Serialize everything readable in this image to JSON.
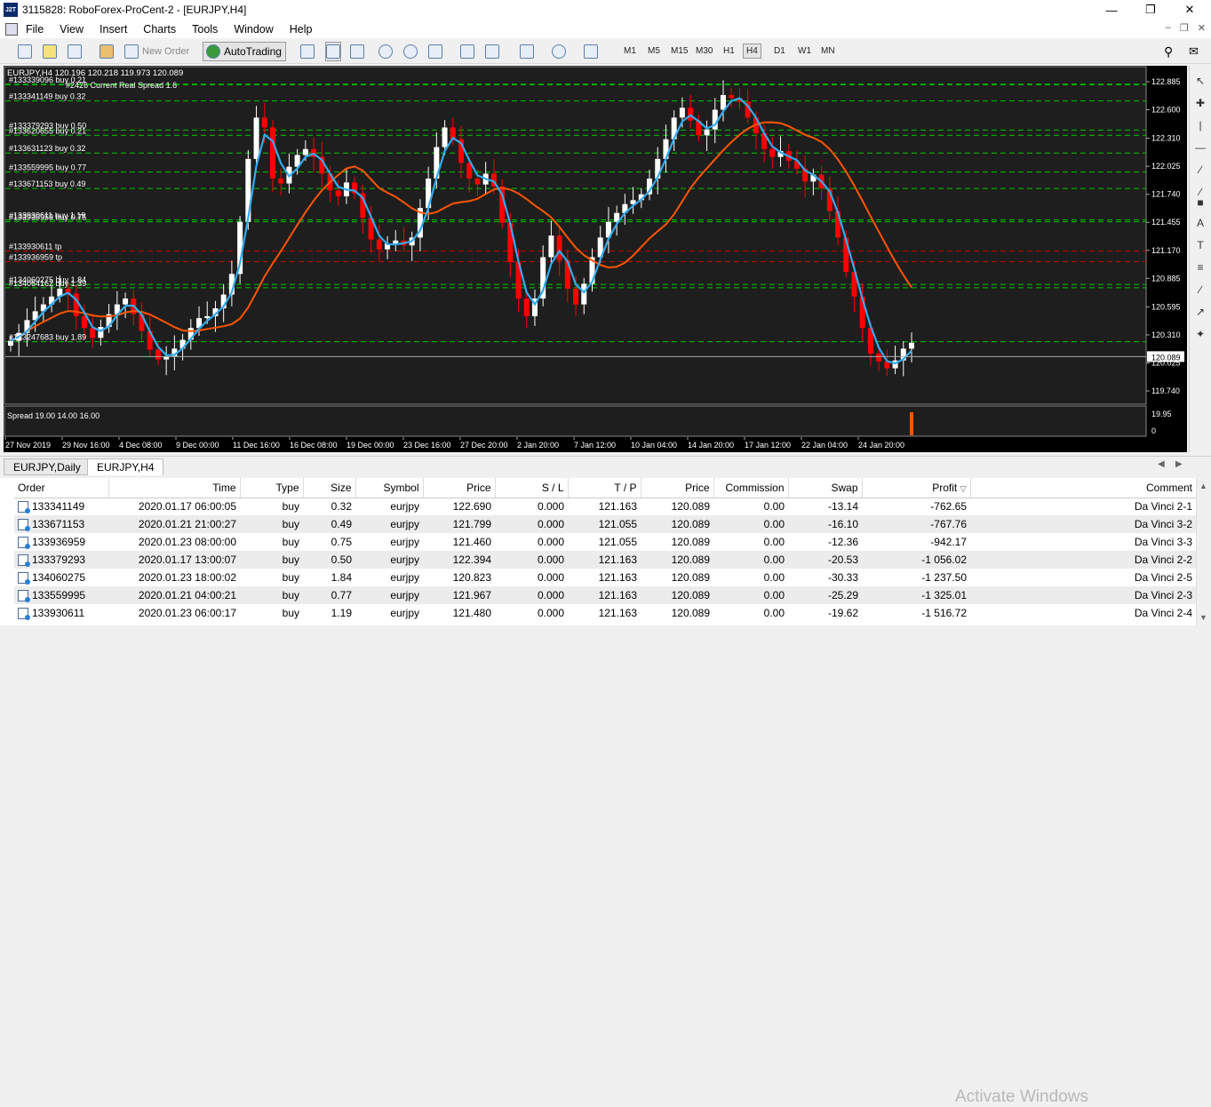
{
  "window": {
    "title": "3115828: RoboForex-ProCent-2 - [EURJPY,H4]",
    "app_icon_label": "J2T",
    "minimize": "—",
    "maximize": "❐",
    "close": "✕"
  },
  "menu": [
    "File",
    "View",
    "Insert",
    "Charts",
    "Tools",
    "Window",
    "Help"
  ],
  "toolbar": {
    "new_order": "New Order",
    "autotrading": "AutoTrading",
    "timeframes": [
      "M1",
      "M5",
      "M15",
      "M30",
      "H1",
      "H4",
      "D1",
      "W1",
      "MN"
    ],
    "active_timeframe": "H4"
  },
  "chart": {
    "header": "EURJPY,H4  120.196 120.218 119.973 120.089",
    "spread_label": "#2426 Current Real Spread 1.6",
    "price_axis": [
      "122.885",
      "122.600",
      "122.310",
      "122.025",
      "121.740",
      "121.455",
      "121.170",
      "120.885",
      "120.595",
      "120.310",
      "120.025",
      "119.740"
    ],
    "current_price": "120.089",
    "time_axis": [
      "27 Nov 2019",
      "29 Nov 16:00",
      "4 Dec 08:00",
      "9 Dec 00:00",
      "11 Dec 16:00",
      "16 Dec 08:00",
      "19 Dec 00:00",
      "23 Dec 16:00",
      "27 Dec 20:00",
      "2 Jan 20:00",
      "7 Jan 12:00",
      "10 Jan 04:00",
      "14 Jan 20:00",
      "17 Jan 12:00",
      "22 Jan 04:00",
      "24 Jan 20:00"
    ],
    "order_labels": [
      {
        "text": "#133339096 buy 0.21",
        "price": 122.86
      },
      {
        "text": "#133341149 buy 0.32",
        "price": 122.69
      },
      {
        "text": "#133379293 buy 0.50",
        "price": 122.394
      },
      {
        "text": "#133620655 buy 0.21",
        "price": 122.34
      },
      {
        "text": "#133631123 buy 0.32",
        "price": 122.16
      },
      {
        "text": "#133559995 buy 0.77",
        "price": 121.967
      },
      {
        "text": "#133671153 buy 0.49",
        "price": 121.799
      },
      {
        "text": "#133930611 buy 1.19",
        "price": 121.48
      },
      {
        "text": "#133936959 buy 0.75",
        "price": 121.46
      },
      {
        "text": "#133930611 tp",
        "price": 121.163
      },
      {
        "text": "#133936959 tp",
        "price": 121.055
      },
      {
        "text": "#134060275 buy 1.84",
        "price": 120.823
      },
      {
        "text": "#134064162 buy 1.39",
        "price": 120.79
      },
      {
        "text": "#133247683 buy 1.89",
        "price": 120.24
      }
    ],
    "indicator": "Spread 19.00 14.00 16.00",
    "indicator_axis": [
      "19.95",
      "0"
    ],
    "colors": {
      "bull": "#ffffff",
      "bear": "#ff0000",
      "ma_fast": "#33aaee",
      "ma_slow": "#ff5500",
      "buy_line": "#00c800",
      "tp_line": "#c80000"
    }
  },
  "chart_tabs": [
    "EURJPY,Daily",
    "EURJPY,H4"
  ],
  "orders": {
    "columns": [
      "Order",
      "Time",
      "Type",
      "Size",
      "Symbol",
      "Price",
      "S / L",
      "T / P",
      "Price",
      "Commission",
      "Swap",
      "Profit",
      "Comment"
    ],
    "rows": [
      [
        "133341149",
        "2020.01.17 06:00:05",
        "buy",
        "0.32",
        "eurjpy",
        "122.690",
        "0.000",
        "121.163",
        "120.089",
        "0.00",
        "-13.14",
        "-762.65",
        "Da Vinci 2-1"
      ],
      [
        "133671153",
        "2020.01.21 21:00:27",
        "buy",
        "0.49",
        "eurjpy",
        "121.799",
        "0.000",
        "121.055",
        "120.089",
        "0.00",
        "-16.10",
        "-767.76",
        "Da Vinci 3-2"
      ],
      [
        "133936959",
        "2020.01.23 08:00:00",
        "buy",
        "0.75",
        "eurjpy",
        "121.460",
        "0.000",
        "121.055",
        "120.089",
        "0.00",
        "-12.36",
        "-942.17",
        "Da Vinci 3-3"
      ],
      [
        "133379293",
        "2020.01.17 13:00:07",
        "buy",
        "0.50",
        "eurjpy",
        "122.394",
        "0.000",
        "121.163",
        "120.089",
        "0.00",
        "-20.53",
        "-1 056.02",
        "Da Vinci 2-2"
      ],
      [
        "134060275",
        "2020.01.23 18:00:02",
        "buy",
        "1.84",
        "eurjpy",
        "120.823",
        "0.000",
        "121.163",
        "120.089",
        "0.00",
        "-30.33",
        "-1 237.50",
        "Da Vinci 2-5"
      ],
      [
        "133559995",
        "2020.01.21 04:00:21",
        "buy",
        "0.77",
        "eurjpy",
        "121.967",
        "0.000",
        "121.163",
        "120.089",
        "0.00",
        "-25.29",
        "-1 325.01",
        "Da Vinci 2-3"
      ],
      [
        "133930611",
        "2020.01.23 06:00:17",
        "buy",
        "1.19",
        "eurjpy",
        "121.480",
        "0.000",
        "121.163",
        "120.089",
        "0.00",
        "-19.62",
        "-1 516.72",
        "Da Vinci 2-4"
      ]
    ]
  },
  "watermark": "Activate Windows",
  "chart_data": {
    "type": "candlestick",
    "y_range": [
      119.74,
      122.885
    ],
    "close_path": [
      120.25,
      120.33,
      120.46,
      120.55,
      120.62,
      120.7,
      120.78,
      120.73,
      120.5,
      120.38,
      120.28,
      120.39,
      120.52,
      120.62,
      120.68,
      120.52,
      120.35,
      120.16,
      120.06,
      120.09,
      120.17,
      120.26,
      120.38,
      120.48,
      120.5,
      120.58,
      120.72,
      120.93,
      121.46,
      122.1,
      122.52,
      122.42,
      121.9,
      121.85,
      122.02,
      122.14,
      122.2,
      122.12,
      121.95,
      121.78,
      121.72,
      121.86,
      121.75,
      121.5,
      121.28,
      121.18,
      121.24,
      121.27,
      121.22,
      121.3,
      121.6,
      121.9,
      122.22,
      122.42,
      122.3,
      122.06,
      121.9,
      121.84,
      121.95,
      121.82,
      121.45,
      121.05,
      120.68,
      120.5,
      120.68,
      121.1,
      121.32,
      121.07,
      120.78,
      120.62,
      120.83,
      121.1,
      121.3,
      121.46,
      121.55,
      121.64,
      121.68,
      121.74,
      121.9,
      122.1,
      122.3,
      122.52,
      122.62,
      122.49,
      122.34,
      122.4,
      122.6,
      122.75,
      122.72,
      122.68,
      122.52,
      122.36,
      122.2,
      122.12,
      122.18,
      122.08,
      122.0,
      121.87,
      121.94,
      121.8,
      121.57,
      121.3,
      120.95,
      120.7,
      120.38,
      120.12,
      120.04,
      119.97,
      120.05,
      120.17,
      120.23
    ]
  }
}
